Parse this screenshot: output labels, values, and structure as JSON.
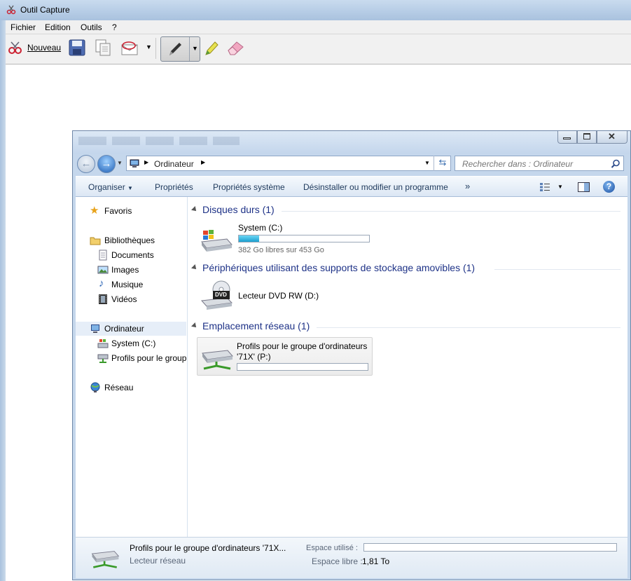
{
  "outer": {
    "title": "Outil Capture",
    "menu": [
      "Fichier",
      "Edition",
      "Outils",
      "?"
    ],
    "toolbar": {
      "new_label": "Nouveau"
    }
  },
  "explorer": {
    "address": {
      "crumb": "Ordinateur"
    },
    "search": {
      "placeholder": "Rechercher dans : Ordinateur"
    },
    "commands": [
      "Organiser",
      "Propriétés",
      "Propriétés système",
      "Désinstaller ou modifier un programme",
      "»"
    ],
    "nav": {
      "favorites": "Favoris",
      "libraries": "Bibliothèques",
      "documents": "Documents",
      "images": "Images",
      "music": "Musique",
      "videos": "Vidéos",
      "computer": "Ordinateur",
      "system_c": "System (C:)",
      "profiles": "Profils pour le group",
      "network": "Réseau"
    },
    "groups": {
      "hard_disks": "Disques durs (1)",
      "removable": "Périphériques utilisant des supports de stockage amovibles (1)",
      "network_location": "Emplacement réseau (1)"
    },
    "drives": {
      "c_name": "System (C:)",
      "c_free": "382 Go libres sur 453 Go",
      "c_fill_fraction": 0.157,
      "dvd_name": "Lecteur DVD RW (D:)",
      "dvd_label": "DVD",
      "net_name_line1": "Profils pour le groupe d'ordinateurs",
      "net_name_line2": "'71X' (P:)",
      "net_fill_fraction": 0.0
    },
    "details": {
      "name": "Profils pour le groupe d'ordinateurs '71X...",
      "type": "Lecteur réseau",
      "used_label": "Espace utilisé :",
      "free_label": "Espace libre :",
      "free_value": "1,81 To"
    }
  },
  "colors": {
    "group_title": "#1e3287",
    "bar_fill": "#1b9fcf"
  }
}
